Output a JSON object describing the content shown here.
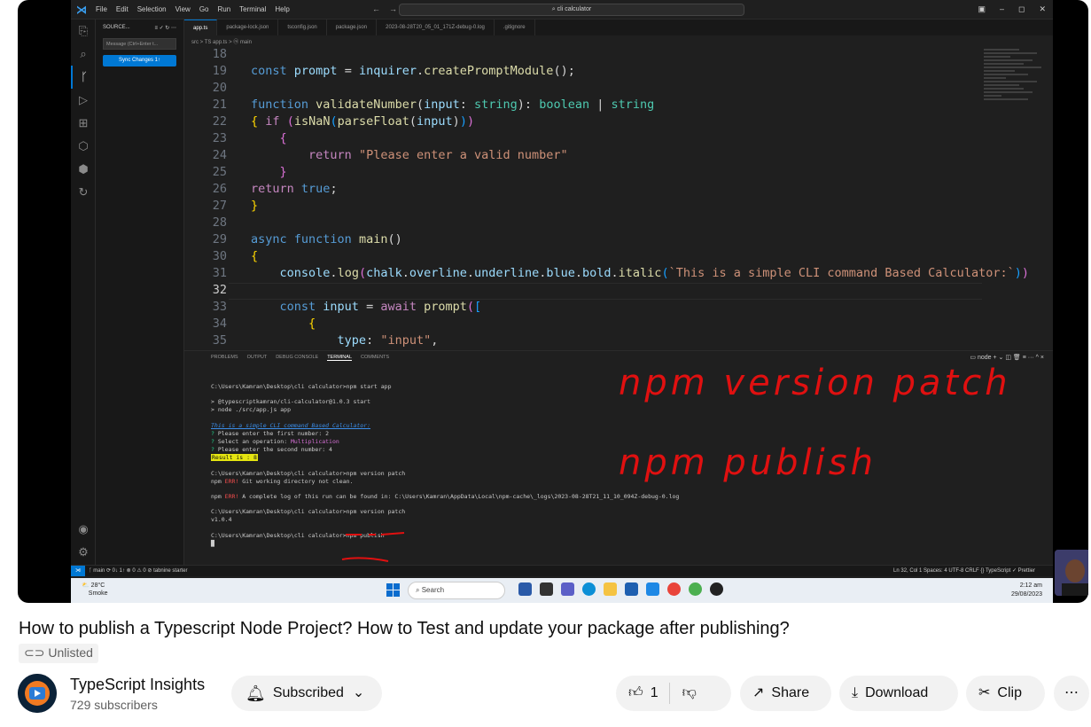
{
  "vscode": {
    "menu": [
      "File",
      "Edit",
      "Selection",
      "View",
      "Go",
      "Run",
      "Terminal",
      "Help"
    ],
    "search": "cli calculator",
    "sidebar": {
      "title": "SOURCE...",
      "message_placeholder": "Message (Ctrl+Enter t...",
      "sync_button": "Sync Changes 1↑"
    },
    "tabs": [
      "app.ts",
      "package-lock.json",
      "tsconfig.json",
      "package.json",
      "2023-08-28T20_05_01_171Z-debug-0.log",
      ".gitignore"
    ],
    "breadcrumb": "src > TS app.ts > ⓜ main",
    "code_lines": [
      {
        "n": "18",
        "html": ""
      },
      {
        "n": "19",
        "html": "<span class='kw'>const</span> <span class='var'>prompt</span> = <span class='var'>inquirer</span>.<span class='fn'>createPromptModule</span>();"
      },
      {
        "n": "20",
        "html": ""
      },
      {
        "n": "21",
        "html": "<span class='kw'>function</span> <span class='fn'>validateNumber</span>(<span class='var'>input</span>: <span class='ty'>string</span>): <span class='ty'>boolean</span> | <span class='ty'>string</span>"
      },
      {
        "n": "22",
        "html": "<span class='br1'>{</span> <span class='ctl'>if</span> <span class='br2'>(</span><span class='fn'>isNaN</span><span class='br3'>(</span><span class='fn'>parseFloat</span>(<span class='var'>input</span>)<span class='br3'>)</span><span class='br2'>)</span>"
      },
      {
        "n": "23",
        "html": "    <span class='br2'>{</span>"
      },
      {
        "n": "24",
        "html": "        <span class='ctl'>return</span> <span class='str'>\"Please enter a valid number\"</span>"
      },
      {
        "n": "25",
        "html": "    <span class='br2'>}</span>"
      },
      {
        "n": "26",
        "html": "<span class='ctl'>return</span> <span class='kw'>true</span>;"
      },
      {
        "n": "27",
        "html": "<span class='br1'>}</span>"
      },
      {
        "n": "28",
        "html": ""
      },
      {
        "n": "29",
        "html": "<span class='kw'>async</span> <span class='kw'>function</span> <span class='fn'>main</span>()"
      },
      {
        "n": "30",
        "html": "<span class='br1'>{</span>"
      },
      {
        "n": "31",
        "html": "    <span class='var'>console</span>.<span class='fn'>log</span><span class='br2'>(</span><span class='var'>chalk</span>.<span class='var'>overline</span>.<span class='var'>underline</span>.<span class='var'>blue</span>.<span class='var'>bold</span>.<span class='fn'>italic</span><span class='br3'>(</span><span class='str'>`This is a simple CLI command Based Calculator:`</span><span class='br3'>)</span><span class='br2'>)</span>"
      },
      {
        "n": "32",
        "html": ""
      },
      {
        "n": "33",
        "html": "    <span class='kw'>const</span> <span class='var'>input</span> = <span class='ctl'>await</span> <span class='fn'>prompt</span><span class='br2'>(</span><span class='br3'>[</span>"
      },
      {
        "n": "34",
        "html": "        <span class='br1'>{</span>"
      },
      {
        "n": "35",
        "html": "            <span class='var'>type</span>: <span class='str'>\"input\"</span>,"
      }
    ],
    "panel_tabs": [
      "PROBLEMS",
      "OUTPUT",
      "DEBUG CONSOLE",
      "TERMINAL",
      "COMMENTS"
    ],
    "panel_right": "▭ node  + ⌄ ◫ 🗑 ≡ ··· ^ ×",
    "terminal": [
      {
        "html": "C:\\Users\\Kamran\\Desktop\\cli calculator>npm start app"
      },
      {
        "html": ""
      },
      {
        "html": "> @typescriptkamran/cli-calculator@1.0.3 start"
      },
      {
        "html": "> node ./src/app.js app"
      },
      {
        "html": ""
      },
      {
        "html": "<span class='cyan'>This is a simple CLI command Based Calculator:</span>"
      },
      {
        "html": "<span class='green'>?</span> Please enter the first number: 2"
      },
      {
        "html": "<span class='green'>?</span> Select an operation: <span class='mag'>Multiplication</span>"
      },
      {
        "html": "<span class='green'>?</span> Please enter the second number: 4"
      },
      {
        "html": "<span class='yel'>Result is : 8</span>"
      },
      {
        "html": ""
      },
      {
        "html": "C:\\Users\\Kamran\\Desktop\\cli calculator>npm version patch"
      },
      {
        "html": "npm <span class='err'>ERR!</span> Git working directory not clean."
      },
      {
        "html": ""
      },
      {
        "html": "npm <span class='err'>ERR!</span> A complete log of this run can be found in: C:\\Users\\Kamran\\AppData\\Local\\npm-cache\\_logs\\2023-08-28T21_11_10_094Z-debug-0.log"
      },
      {
        "html": ""
      },
      {
        "html": "C:\\Users\\Kamran\\Desktop\\cli calculator>npm version patch"
      },
      {
        "html": "v1.0.4"
      },
      {
        "html": ""
      },
      {
        "html": "C:\\Users\\Kamran\\Desktop\\cli calculator>npm publish"
      },
      {
        "html": "█"
      }
    ],
    "handwriting": [
      "npm version patch",
      "npm publish"
    ],
    "status_left": "ᚴ main ⟳ 0↓ 1↑  ⊗ 0 ⚠ 0  ⊘ tabnine starter",
    "status_right": "Ln 32, Col 1   Spaces: 4   UTF-8   CRLF   {} TypeScript   ✓ Prettier",
    "taskbar": {
      "temp": "28°C",
      "weather": "Smoke",
      "search": "Search",
      "time": "2:12 am",
      "date": "29/08/2023"
    }
  },
  "video": {
    "title": "How to publish a Typescript Node Project? How to Test and update your package after publishing?",
    "visibility": "Unlisted",
    "channel": "TypeScript Insights",
    "subscribers": "729 subscribers",
    "subscribe_label": "Subscribed",
    "likes": "1",
    "share": "Share",
    "download": "Download",
    "clip": "Clip"
  }
}
